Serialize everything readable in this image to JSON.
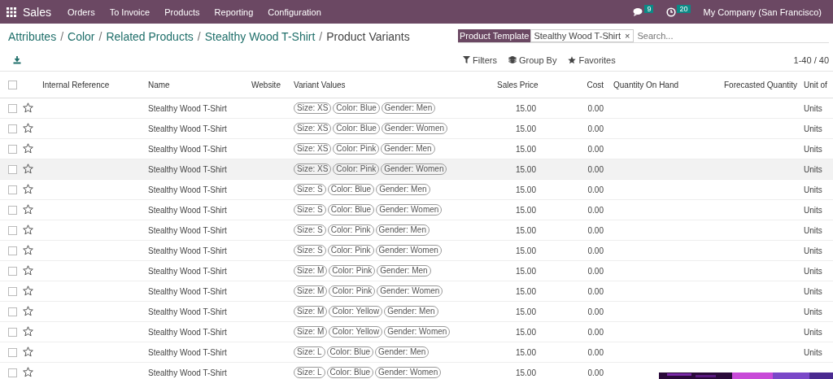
{
  "navbar": {
    "app": "Sales",
    "menu": [
      "Orders",
      "To Invoice",
      "Products",
      "Reporting",
      "Configuration"
    ],
    "messages_count": "9",
    "activities_count": "20",
    "company": "My Company (San Francisco)"
  },
  "breadcrumb": {
    "links": [
      {
        "text": "Attributes",
        "separator": "/"
      },
      {
        "text": "Color",
        "separator": "/"
      },
      {
        "text": "Related Products",
        "separator": "/"
      },
      {
        "text": "Stealthy Wood T-Shirt",
        "separator": "/"
      }
    ],
    "current": "Product Variants"
  },
  "search": {
    "facet_label": "Product Template",
    "facet_value": "Stealthy Wood T-Shirt",
    "facet_remove": "×",
    "placeholder": "Search..."
  },
  "toolbar": {
    "filters": "Filters",
    "group_by": "Group By",
    "favorites": "Favorites",
    "pager": "1-40 / 40"
  },
  "table": {
    "select_all_checked": false,
    "columns": [
      "Internal Reference",
      "Name",
      "Website",
      "Variant Values",
      "Sales Price",
      "Cost",
      "Quantity On Hand",
      "Forecasted Quantity",
      "Unit of"
    ],
    "rows": [
      {
        "highlighted": false,
        "name": "Stealthy Wood T-Shirt",
        "values": [
          "Size: XS",
          "Color: Blue",
          "Gender: Men"
        ],
        "price": "15.00",
        "cost": "0.00",
        "unit": "Units"
      },
      {
        "highlighted": false,
        "name": "Stealthy Wood T-Shirt",
        "values": [
          "Size: XS",
          "Color: Blue",
          "Gender: Women"
        ],
        "price": "15.00",
        "cost": "0.00",
        "unit": "Units"
      },
      {
        "highlighted": false,
        "name": "Stealthy Wood T-Shirt",
        "values": [
          "Size: XS",
          "Color: Pink",
          "Gender: Men"
        ],
        "price": "15.00",
        "cost": "0.00",
        "unit": "Units"
      },
      {
        "highlighted": true,
        "name": "Stealthy Wood T-Shirt",
        "values": [
          "Size: XS",
          "Color: Pink",
          "Gender: Women"
        ],
        "price": "15.00",
        "cost": "0.00",
        "unit": "Units"
      },
      {
        "highlighted": false,
        "name": "Stealthy Wood T-Shirt",
        "values": [
          "Size: S",
          "Color: Blue",
          "Gender: Men"
        ],
        "price": "15.00",
        "cost": "0.00",
        "unit": "Units"
      },
      {
        "highlighted": false,
        "name": "Stealthy Wood T-Shirt",
        "values": [
          "Size: S",
          "Color: Blue",
          "Gender: Women"
        ],
        "price": "15.00",
        "cost": "0.00",
        "unit": "Units"
      },
      {
        "highlighted": false,
        "name": "Stealthy Wood T-Shirt",
        "values": [
          "Size: S",
          "Color: Pink",
          "Gender: Men"
        ],
        "price": "15.00",
        "cost": "0.00",
        "unit": "Units"
      },
      {
        "highlighted": false,
        "name": "Stealthy Wood T-Shirt",
        "values": [
          "Size: S",
          "Color: Pink",
          "Gender: Women"
        ],
        "price": "15.00",
        "cost": "0.00",
        "unit": "Units"
      },
      {
        "highlighted": false,
        "name": "Stealthy Wood T-Shirt",
        "values": [
          "Size: M",
          "Color: Pink",
          "Gender: Men"
        ],
        "price": "15.00",
        "cost": "0.00",
        "unit": "Units"
      },
      {
        "highlighted": false,
        "name": "Stealthy Wood T-Shirt",
        "values": [
          "Size: M",
          "Color: Pink",
          "Gender: Women"
        ],
        "price": "15.00",
        "cost": "0.00",
        "unit": "Units"
      },
      {
        "highlighted": false,
        "name": "Stealthy Wood T-Shirt",
        "values": [
          "Size: M",
          "Color: Yellow",
          "Gender: Men"
        ],
        "price": "15.00",
        "cost": "0.00",
        "unit": "Units"
      },
      {
        "highlighted": false,
        "name": "Stealthy Wood T-Shirt",
        "values": [
          "Size: M",
          "Color: Yellow",
          "Gender: Women"
        ],
        "price": "15.00",
        "cost": "0.00",
        "unit": "Units"
      },
      {
        "highlighted": false,
        "name": "Stealthy Wood T-Shirt",
        "values": [
          "Size: L",
          "Color: Blue",
          "Gender: Men"
        ],
        "price": "15.00",
        "cost": "0.00",
        "unit": "Units"
      },
      {
        "highlighted": false,
        "name": "Stealthy Wood T-Shirt",
        "values": [
          "Size: L",
          "Color: Blue",
          "Gender: Women"
        ],
        "price": "15.00",
        "cost": "0.00"
      }
    ]
  }
}
